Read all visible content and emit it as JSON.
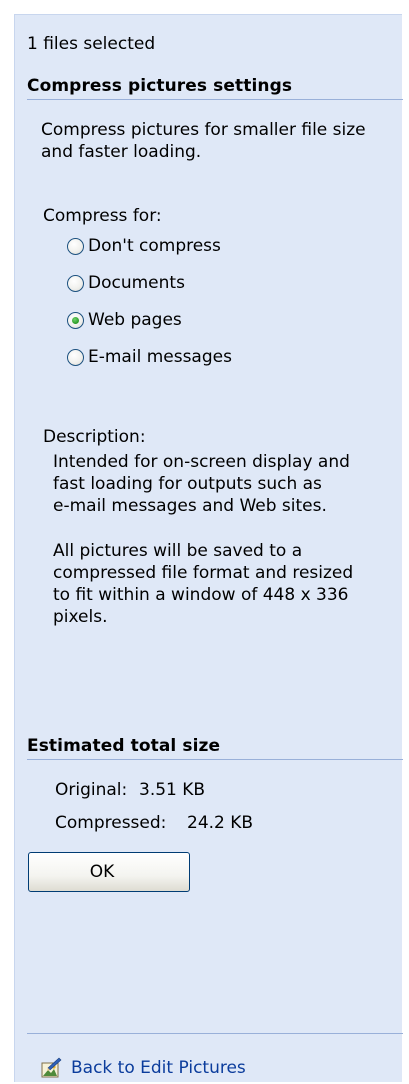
{
  "selection": {
    "status": "1 files selected"
  },
  "settings": {
    "heading": "Compress pictures settings",
    "intro_line1": "Compress pictures for smaller file size",
    "intro_line2": "and faster loading.",
    "compress_for_label": "Compress for:",
    "options": [
      {
        "label": "Don't compress",
        "checked": false
      },
      {
        "label": "Documents",
        "checked": false
      },
      {
        "label": "Web pages",
        "checked": true
      },
      {
        "label": "E-mail messages",
        "checked": false
      }
    ],
    "description_label": "Description:",
    "description_lines": [
      "Intended for on-screen display and",
      "fast loading for outputs such as",
      "e-mail messages and Web sites."
    ],
    "note_lines": [
      "All pictures will be saved to a",
      "compressed file format and resized",
      "to fit within a window of 448 x 336",
      "pixels."
    ]
  },
  "estimate": {
    "heading": "Estimated total size",
    "original_label": "Original:",
    "original_value": "3.51 KB",
    "compressed_label": "Compressed:",
    "compressed_value": "24.2 KB"
  },
  "actions": {
    "ok_label": "OK",
    "back_link": "Back to Edit Pictures",
    "back_icon": "edit-pictures-icon"
  },
  "colors": {
    "pane_background": "#dfe8f7",
    "rule": "#99b0d9",
    "link": "#0b3c9c"
  }
}
